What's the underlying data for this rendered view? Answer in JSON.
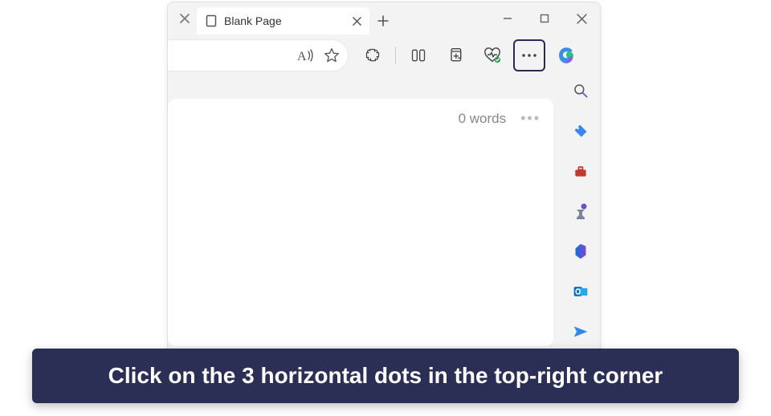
{
  "tab": {
    "title": "Blank Page"
  },
  "page": {
    "word_count": "0 words"
  },
  "caption": "Click on the 3 horizontal dots in the top-right corner"
}
